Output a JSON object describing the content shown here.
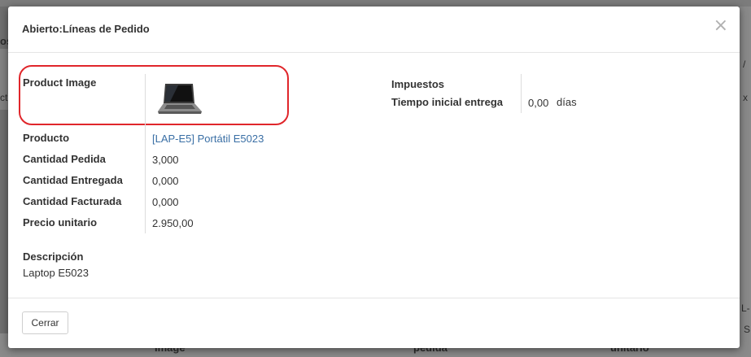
{
  "background": {
    "fragment_top_left": "os",
    "fragment_left_row": "ct",
    "fragment_right_slash": "/",
    "fragment_right_row": "x",
    "fragment_right_mid": "L-",
    "fragment_right_low": "S",
    "fragment_bottom_left": "Image",
    "fragment_bottom_mid": "pedida",
    "fragment_bottom_right": "unitario"
  },
  "modal": {
    "title": "Abierto:Líneas de Pedido",
    "close_label": "×",
    "fields_left": [
      {
        "label": "Product Image",
        "type": "image",
        "image_icon": "laptop-image"
      },
      {
        "label": "Producto",
        "value": "[LAP-E5] Portátil E5023",
        "type": "link"
      },
      {
        "label": "Cantidad Pedida",
        "value": "3,000"
      },
      {
        "label": "Cantidad Entregada",
        "value": "0,000"
      },
      {
        "label": "Cantidad Facturada",
        "value": "0,000"
      },
      {
        "label": "Precio unitario",
        "value": "2.950,00"
      }
    ],
    "fields_right": [
      {
        "label": "Impuestos",
        "value": ""
      },
      {
        "label": "Tiempo inicial entrega",
        "value": "0,00",
        "unit": "días"
      }
    ],
    "description": {
      "label": "Descripción",
      "value": "Laptop E5023"
    },
    "footer": {
      "close_button": "Cerrar"
    }
  },
  "colors": {
    "highlight": "#e0262b",
    "link": "#3a6fa5"
  }
}
